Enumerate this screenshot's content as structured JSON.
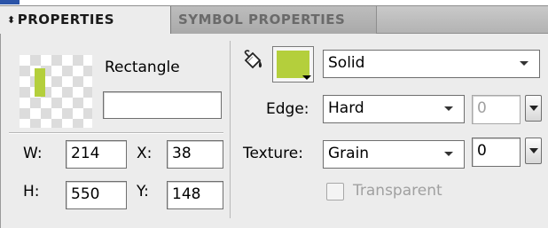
{
  "tabs": [
    {
      "label": "PROPERTIES",
      "active": true
    },
    {
      "label": "SYMBOL PROPERTIES",
      "active": false
    }
  ],
  "object": {
    "type_label": "Rectangle",
    "name_value": "",
    "thumbnail_color": "#b4cf3c"
  },
  "geometry": {
    "w_label": "W:",
    "w_value": "214",
    "x_label": "X:",
    "x_value": "38",
    "h_label": "H:",
    "h_value": "550",
    "y_label": "Y:",
    "y_value": "148"
  },
  "fill": {
    "icon": "paint-bucket-icon",
    "color": "#b4cf3c",
    "style_value": "Solid"
  },
  "edge": {
    "label": "Edge:",
    "value": "Hard",
    "amount": "0"
  },
  "texture": {
    "label": "Texture:",
    "value": "Grain",
    "amount": "0"
  },
  "transparent": {
    "label": "Transparent",
    "checked": false
  }
}
